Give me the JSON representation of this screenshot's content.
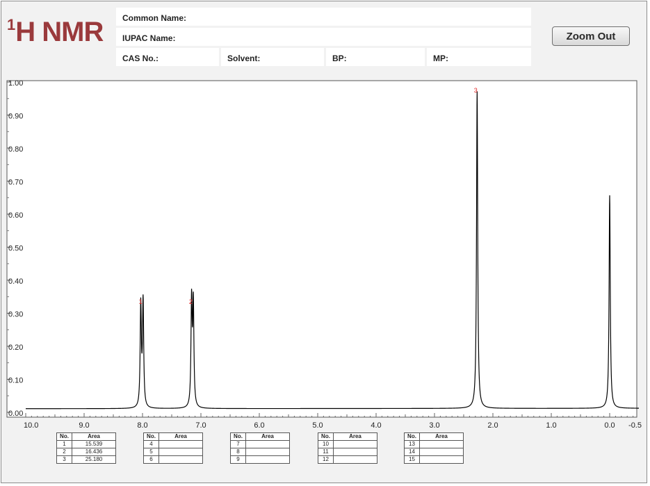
{
  "header": {
    "logo_sup": "1",
    "logo_text": "H NMR",
    "fields": {
      "common_name": "Common Name:",
      "iupac_name": "IUPAC Name:",
      "cas_no": "CAS No.:",
      "solvent": "Solvent:",
      "bp": "BP:",
      "mp": "MP:"
    },
    "zoom_out_label": "Zoom Out"
  },
  "chart_data": {
    "type": "line",
    "title": "",
    "xlabel": "",
    "ylabel": "",
    "x_reversed": true,
    "xlim": [
      10.0,
      -0.5
    ],
    "ylim": [
      0.0,
      1.0
    ],
    "grid": false,
    "x_ticks": [
      {
        "value": 10.0,
        "label": "10.0"
      },
      {
        "value": 9.0,
        "label": "9.0"
      },
      {
        "value": 8.0,
        "label": "8.0"
      },
      {
        "value": 7.0,
        "label": "7.0"
      },
      {
        "value": 6.0,
        "label": "6.0"
      },
      {
        "value": 5.0,
        "label": "5.0"
      },
      {
        "value": 4.0,
        "label": "4.0"
      },
      {
        "value": 3.0,
        "label": "3.0"
      },
      {
        "value": 2.0,
        "label": "2.0"
      },
      {
        "value": 1.0,
        "label": "1.0"
      },
      {
        "value": 0.0,
        "label": "0.0"
      },
      {
        "value": -0.5,
        "label": "-0.5"
      }
    ],
    "y_ticks": [
      {
        "value": 1.0,
        "label": "1.00"
      },
      {
        "value": 0.9,
        "label": "0.90"
      },
      {
        "value": 0.8,
        "label": "0.80"
      },
      {
        "value": 0.7,
        "label": "0.70"
      },
      {
        "value": 0.6,
        "label": "0.60"
      },
      {
        "value": 0.5,
        "label": "0.50"
      },
      {
        "value": 0.4,
        "label": "0.40"
      },
      {
        "value": 0.3,
        "label": "0.30"
      },
      {
        "value": 0.2,
        "label": "0.20"
      },
      {
        "value": 0.1,
        "label": "0.10"
      },
      {
        "value": 0.0,
        "label": "0.00"
      }
    ],
    "baseline": {
      "left": 0.011,
      "right": 0.012
    },
    "peaks": [
      {
        "label": "1",
        "center": 8.01,
        "lines": [
          {
            "x": 8.03,
            "y": 0.31
          },
          {
            "x": 7.99,
            "y": 0.32
          }
        ],
        "width": 0.012
      },
      {
        "label": "2",
        "center": 7.15,
        "lines": [
          {
            "x": 7.16,
            "y": 0.32
          },
          {
            "x": 7.13,
            "y": 0.31
          }
        ],
        "width": 0.012
      },
      {
        "label": "3",
        "center": 2.27,
        "lines": [
          {
            "x": 2.27,
            "y": 0.96
          }
        ],
        "width": 0.012
      },
      {
        "label": "",
        "center": 0.0,
        "lines": [
          {
            "x": 0.0,
            "y": 0.645
          }
        ],
        "width": 0.012
      }
    ],
    "area_tables": [
      {
        "headers": [
          "No.",
          "Area"
        ],
        "rows": [
          [
            "1",
            "15.539"
          ],
          [
            "2",
            "16.436"
          ],
          [
            "3",
            "25.180"
          ]
        ]
      },
      {
        "headers": [
          "No.",
          "Area"
        ],
        "rows": [
          [
            "4",
            ""
          ],
          [
            "5",
            ""
          ],
          [
            "6",
            ""
          ]
        ]
      },
      {
        "headers": [
          "No.",
          "Area"
        ],
        "rows": [
          [
            "7",
            ""
          ],
          [
            "8",
            ""
          ],
          [
            "9",
            ""
          ]
        ]
      },
      {
        "headers": [
          "No.",
          "Area"
        ],
        "rows": [
          [
            "10",
            ""
          ],
          [
            "11",
            ""
          ],
          [
            "12",
            ""
          ]
        ]
      },
      {
        "headers": [
          "No.",
          "Area"
        ],
        "rows": [
          [
            "13",
            ""
          ],
          [
            "14",
            ""
          ],
          [
            "15",
            ""
          ]
        ]
      }
    ],
    "colors": {
      "line": "#000000",
      "peak_label": "#e02020",
      "logo": "#9a3a3c"
    }
  }
}
